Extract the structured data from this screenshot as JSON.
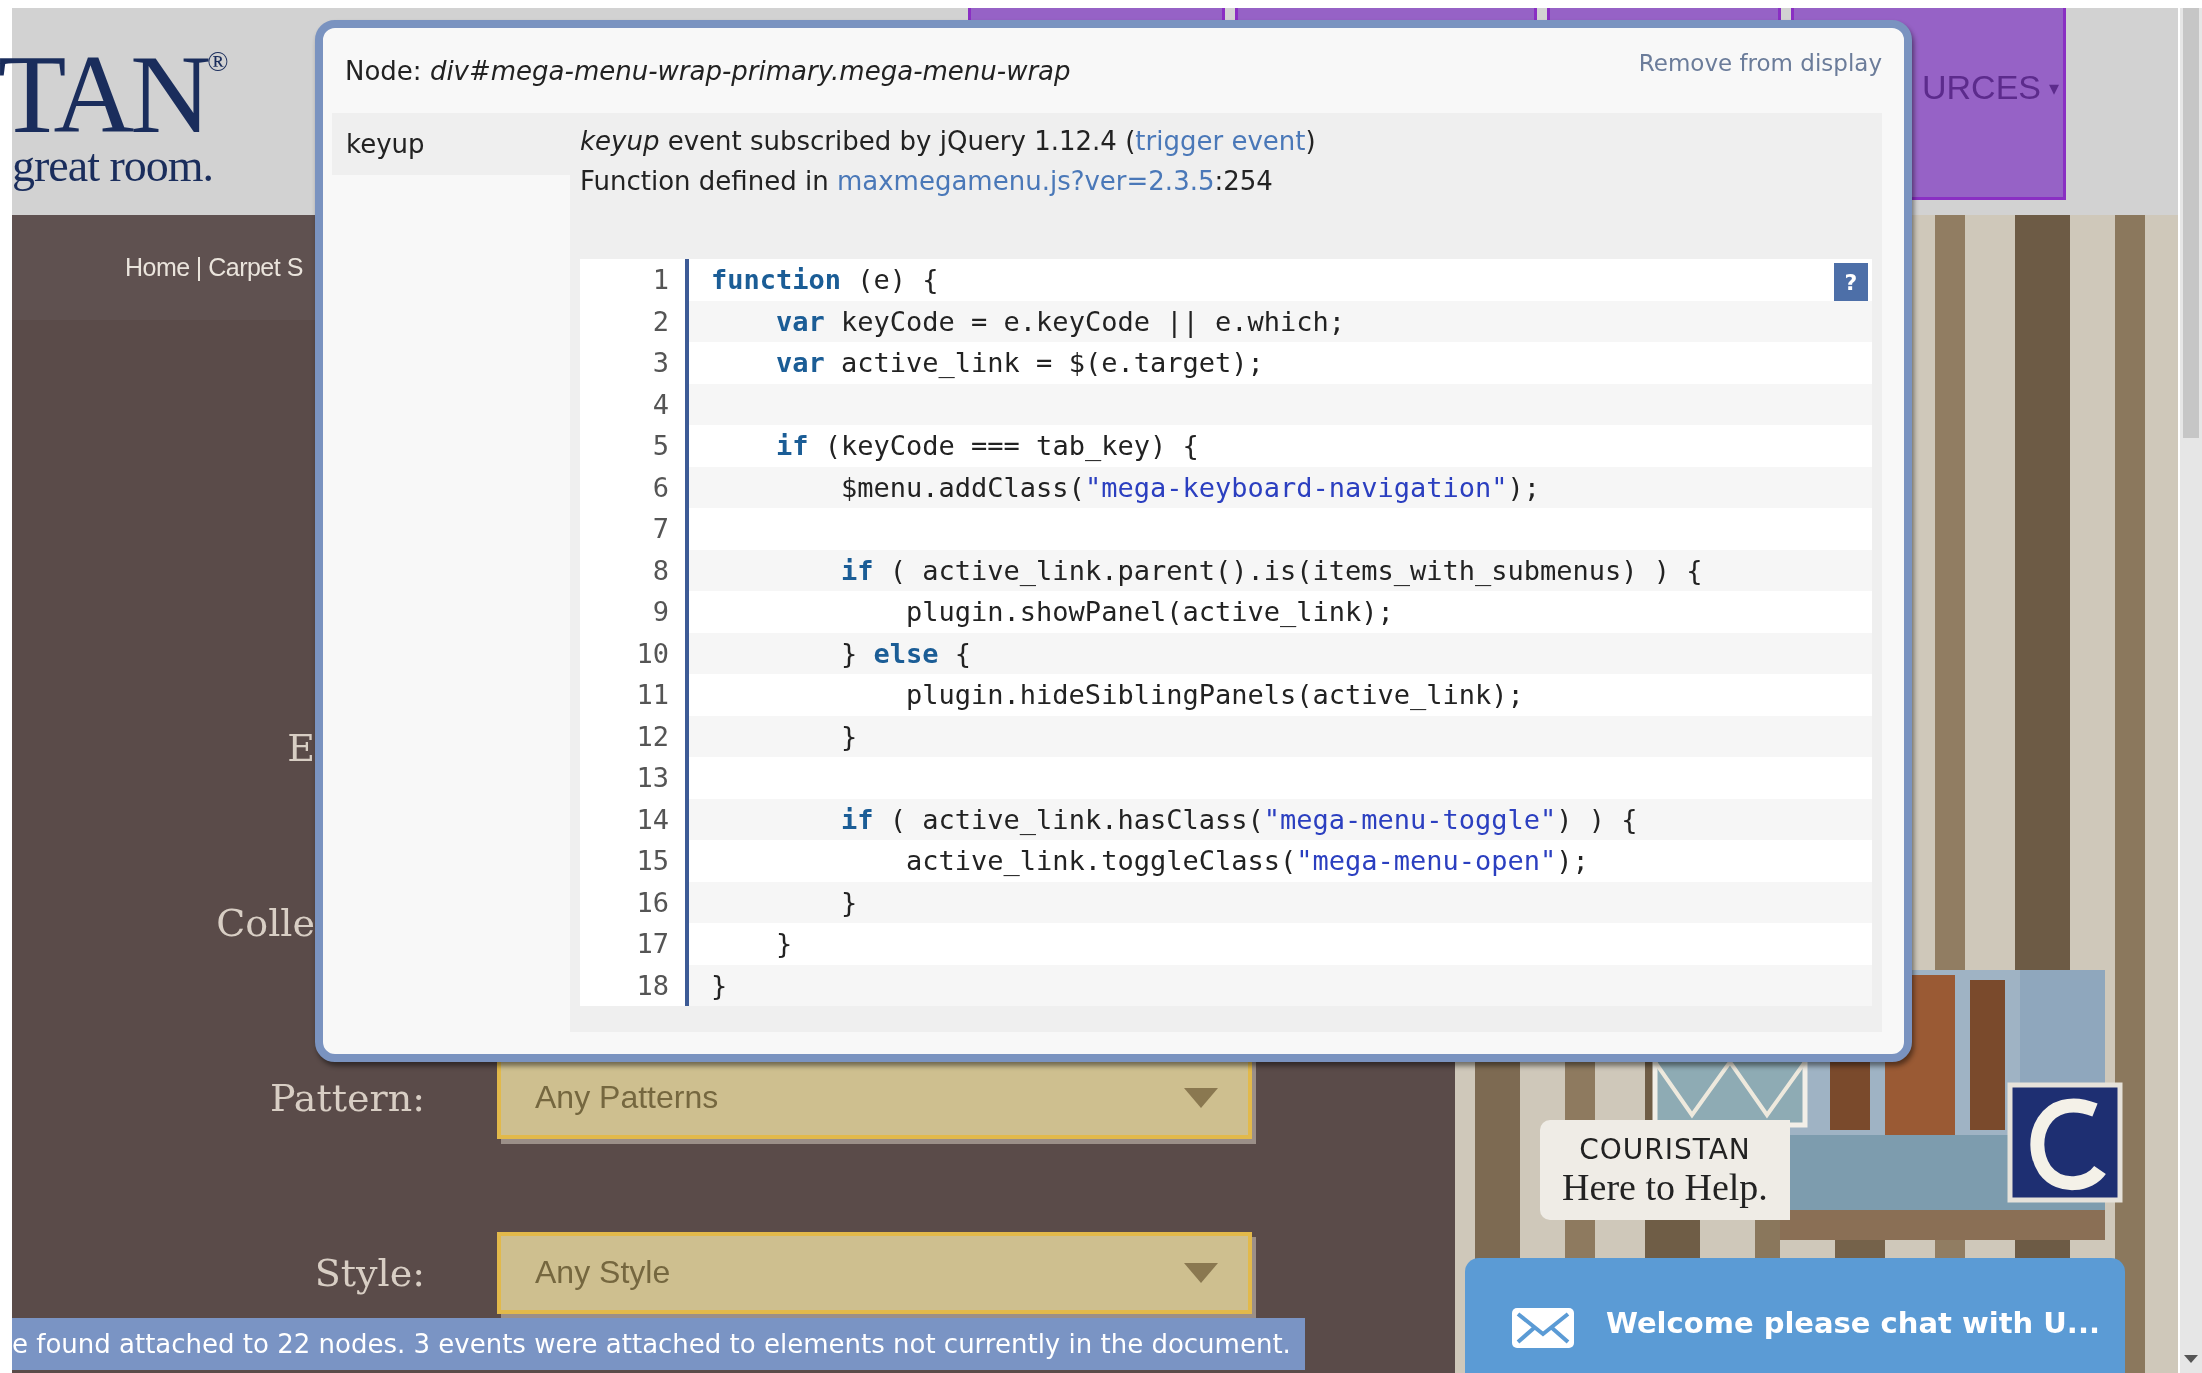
{
  "site": {
    "logo": {
      "wordmark": "TAN",
      "mark": "®",
      "tagline": "great room."
    },
    "nav": {
      "visible_label": "URCES",
      "caret": "▾"
    },
    "breadcrumb": {
      "items": [
        "Home",
        "Carpet S"
      ],
      "separator": "|"
    },
    "filters": [
      {
        "label": "E"
      },
      {
        "label": "Colle"
      },
      {
        "label": "Pattern:",
        "value": "Any Patterns"
      },
      {
        "label": "Style:",
        "value": "Any Style"
      }
    ],
    "ad": {
      "brand": "COURISTAN",
      "slogan": "Here to Help."
    },
    "chat": {
      "label": "Welcome please chat with U..."
    }
  },
  "dialog": {
    "node": "Node: *div#mega-menu-wrap-primary.mega-menu-wrap*",
    "remove_link": "Remove from display",
    "event": {
      "name": "keyup",
      "subscription": {
        "before": "*keyup* event subscribed by jQuery 1.12.4 (",
        "link": "trigger event",
        "after": ")"
      },
      "definition": {
        "before": "Function defined in ",
        "link": "maxmegamenu.js?ver=2.3.5",
        "after": ":254"
      },
      "help": "?",
      "code": [
        {
          "number": "1",
          "segments": [
            {
              "kind": "keyword",
              "text": "function"
            },
            {
              "kind": "plain",
              "text": " (e) {"
            }
          ]
        },
        {
          "number": "2",
          "segments": [
            {
              "kind": "keyword",
              "text": "    var"
            },
            {
              "kind": "plain",
              "text": " keyCode = e.keyCode || e.which;"
            }
          ]
        },
        {
          "number": "3",
          "segments": [
            {
              "kind": "keyword",
              "text": "    var"
            },
            {
              "kind": "plain",
              "text": " active_link = $(e.target);"
            }
          ]
        },
        {
          "number": "4"
        },
        {
          "number": "5",
          "segments": [
            {
              "kind": "keyword",
              "text": "    if"
            },
            {
              "kind": "plain",
              "text": " (keyCode === tab_key) {"
            }
          ]
        },
        {
          "number": "6",
          "segments": [
            {
              "kind": "plain",
              "text": "        $menu.addClass("
            },
            {
              "kind": "string",
              "text": "\"mega-keyboard-navigation\""
            },
            {
              "kind": "plain",
              "text": ");"
            }
          ]
        },
        {
          "number": "7"
        },
        {
          "number": "8",
          "segments": [
            {
              "kind": "keyword",
              "text": "        if"
            },
            {
              "kind": "plain",
              "text": " ( active_link.parent().is(items_with_submenus) ) {"
            }
          ]
        },
        {
          "number": "9",
          "segments": [
            {
              "kind": "plain",
              "text": "            plugin.showPanel(active_link);"
            }
          ]
        },
        {
          "number": "10",
          "segments": [
            {
              "kind": "plain",
              "text": "        } "
            },
            {
              "kind": "keyword",
              "text": "else"
            },
            {
              "kind": "plain",
              "text": " {"
            }
          ]
        },
        {
          "number": "11",
          "segments": [
            {
              "kind": "plain",
              "text": "            plugin.hideSiblingPanels(active_link);"
            }
          ]
        },
        {
          "number": "12",
          "segments": [
            {
              "kind": "plain",
              "text": "        }"
            }
          ]
        },
        {
          "number": "13"
        },
        {
          "number": "14",
          "segments": [
            {
              "kind": "keyword",
              "text": "        if"
            },
            {
              "kind": "plain",
              "text": " ( active_link.hasClass("
            },
            {
              "kind": "string",
              "text": "\"mega-menu-toggle\""
            },
            {
              "kind": "plain",
              "text": ") ) {"
            }
          ]
        },
        {
          "number": "15",
          "segments": [
            {
              "kind": "plain",
              "text": "            active_link.toggleClass("
            },
            {
              "kind": "string",
              "text": "\"mega-menu-open\""
            },
            {
              "kind": "plain",
              "text": ");"
            }
          ]
        },
        {
          "number": "16",
          "segments": [
            {
              "kind": "plain",
              "text": "        }"
            }
          ]
        },
        {
          "number": "17",
          "segments": [
            {
              "kind": "plain",
              "text": "    }"
            }
          ]
        },
        {
          "number": "18",
          "segments": [
            {
              "kind": "plain",
              "text": "}"
            }
          ]
        }
      ]
    }
  },
  "status_bar": "e found attached to 22 nodes. 3 events were attached to elements not currently in the document."
}
